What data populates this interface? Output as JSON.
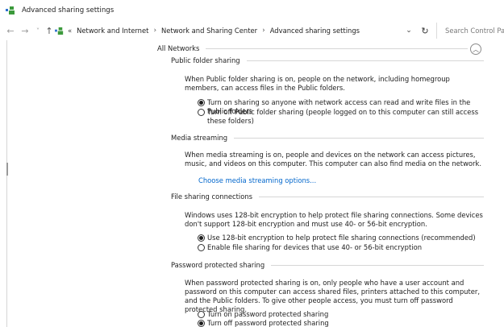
{
  "window": {
    "title": "Advanced sharing settings"
  },
  "toolbar": {
    "back_glyph": "←",
    "forward_glyph": "→",
    "recent_glyph": "˅",
    "up_glyph": "↑",
    "overflow_glyph": "«",
    "breadcrumb": [
      "Network and Internet",
      "Network and Sharing Center",
      "Advanced sharing settings"
    ],
    "separator": "›",
    "dropdown_glyph": "⌄",
    "refresh_glyph": "↻",
    "search_placeholder": "Search Control Panel"
  },
  "network": {
    "label": "All Networks",
    "collapse_glyph": "︿"
  },
  "sections": {
    "public_folder": {
      "title": "Public folder sharing",
      "description": "When Public folder sharing is on, people on the network, including homegroup members, can access files in the Public folders.",
      "options": [
        {
          "label": "Turn on sharing so anyone with network access can read and write files in the Public folders",
          "selected": true
        },
        {
          "label": "Turn off Public folder sharing (people logged on to this computer can still access these folders)",
          "selected": false
        }
      ]
    },
    "media": {
      "title": "Media streaming",
      "description": "When media streaming is on, people and devices on the network can access pictures, music, and videos on this computer. This computer can also find media on the network.",
      "link": "Choose media streaming options..."
    },
    "file_sharing": {
      "title": "File sharing connections",
      "description": "Windows uses 128-bit encryption to help protect file sharing connections. Some devices don't support 128-bit encryption and must use 40- or 56-bit encryption.",
      "options": [
        {
          "label": "Use 128-bit encryption to help protect file sharing connections (recommended)",
          "selected": true
        },
        {
          "label": "Enable file sharing for devices that use 40- or 56-bit encryption",
          "selected": false
        }
      ]
    },
    "password": {
      "title": "Password protected sharing",
      "description": "When password protected sharing is on, only people who have a user account and password on this computer can access shared files, printers attached to this computer, and the Public folders. To give other people access, you must turn off password protected sharing.",
      "options": [
        {
          "label": "Turn on password protected sharing",
          "selected": false
        },
        {
          "label": "Turn off password protected sharing",
          "selected": true
        }
      ]
    }
  },
  "colors": {
    "link": "#0066cc",
    "rule": "#d6d6d6",
    "icon_green": "#3c9a3c",
    "icon_blue": "#2a6fcf"
  }
}
